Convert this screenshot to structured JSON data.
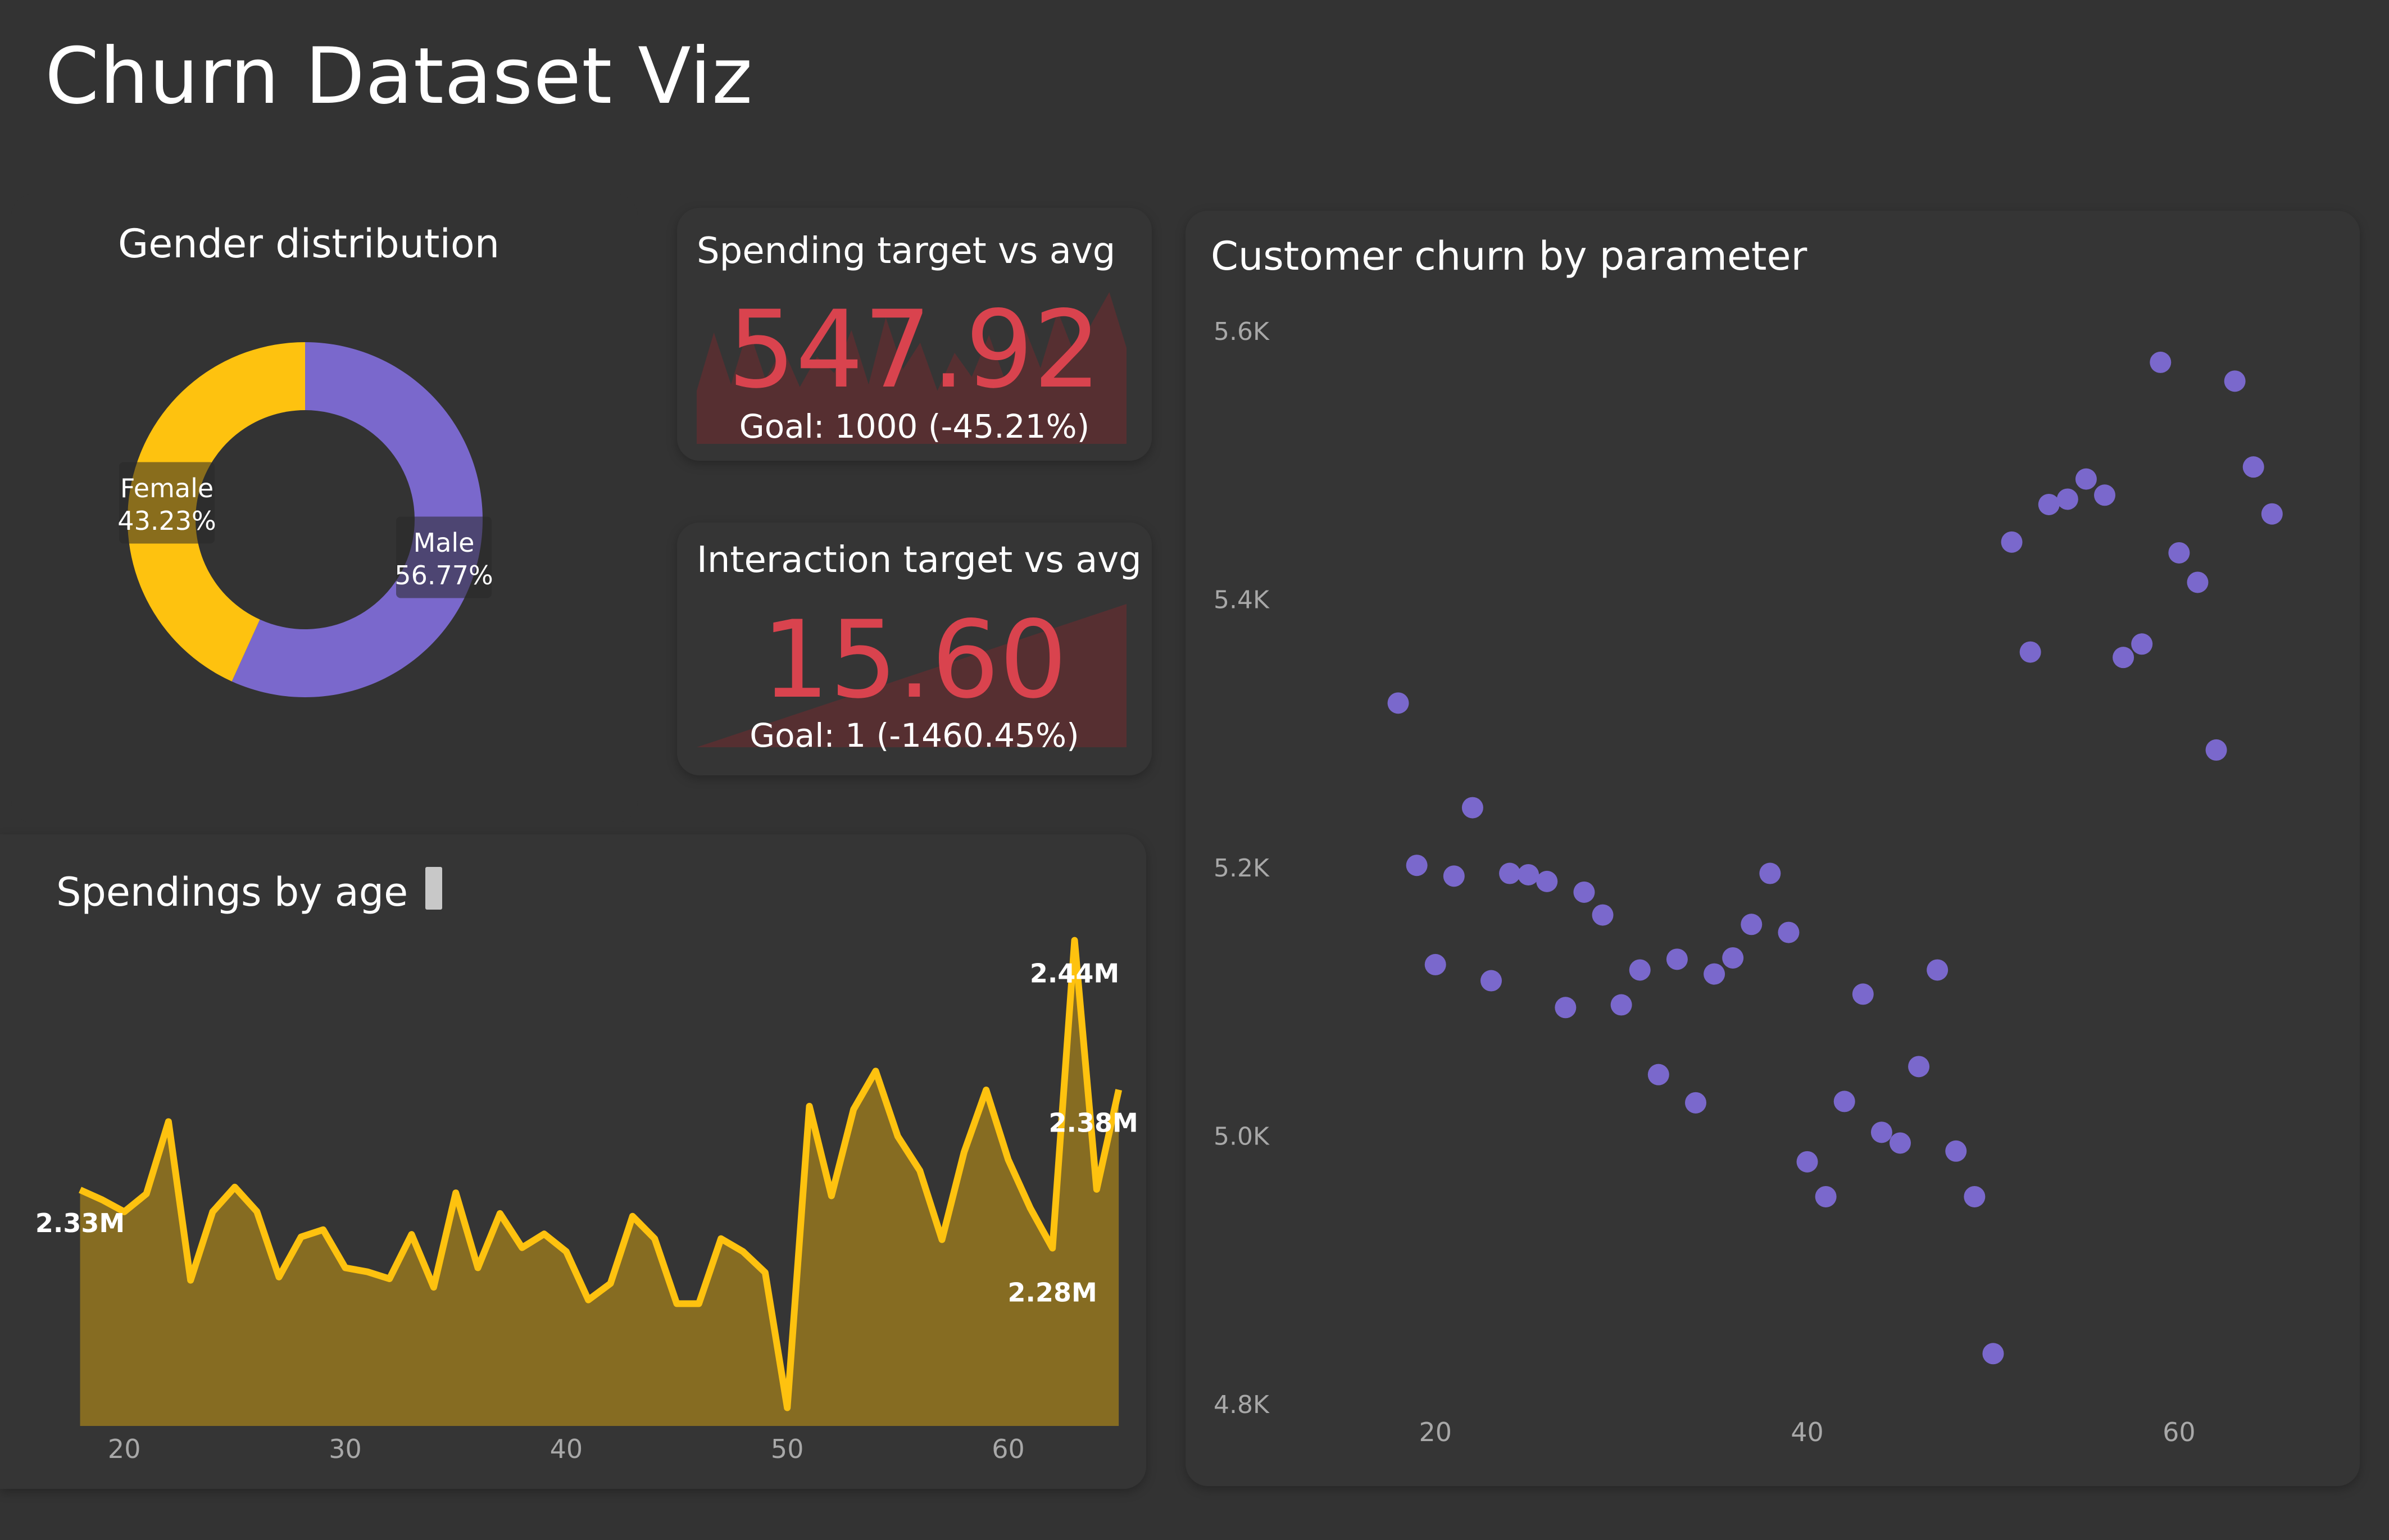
{
  "page": {
    "title": "Churn Dataset Viz"
  },
  "colors": {
    "background": "#333333",
    "male": "#7a68cc",
    "female": "#fec20f",
    "kpi": "#d9434e",
    "kpi_fill": "#5a2f31",
    "line": "#fec20f",
    "area": "#866c22",
    "scatter": "#7a68cc",
    "axis_text": "#a8a8a8"
  },
  "chart_data": [
    {
      "type": "pie",
      "title": "Gender distribution",
      "labels": [
        "Male",
        "Female"
      ],
      "values": [
        56.77,
        43.23
      ],
      "value_labels": [
        "56.77%",
        "43.23%"
      ]
    },
    {
      "type": "kpi",
      "title": "Spending target vs avg",
      "value": "547.92",
      "goal_text": "Goal: 1000 (-45.21%)",
      "trend": [
        420,
        880,
        470,
        920,
        510,
        760,
        450,
        690,
        560,
        900,
        470,
        1000,
        590,
        800,
        420,
        720,
        530,
        860,
        480,
        940,
        600,
        1050,
        700,
        960,
        1200,
        760
      ]
    },
    {
      "type": "kpi",
      "title": "Interaction target vs avg",
      "value": "15.60",
      "goal_text": "Goal: 1 (-1460.45%)",
      "trend": [
        0,
        100
      ]
    },
    {
      "type": "area",
      "title": "Spendings by age",
      "xlim": [
        17.3,
        65.3
      ],
      "xticks": [
        20,
        30,
        40,
        50,
        60
      ],
      "ylim": [
        2.245,
        2.46
      ],
      "x": [
        18,
        19,
        20,
        21,
        22,
        23,
        24,
        25,
        26,
        27,
        28,
        29,
        30,
        31,
        32,
        33,
        34,
        35,
        36,
        37,
        38,
        39,
        40,
        41,
        42,
        43,
        44,
        45,
        46,
        47,
        48,
        49,
        50,
        51,
        52,
        53,
        54,
        55,
        56,
        57,
        58,
        59,
        60,
        61,
        62,
        63,
        64,
        65
      ],
      "values": [
        2.3398,
        2.3358,
        2.331,
        2.3382,
        2.3672,
        2.3035,
        2.331,
        2.3409,
        2.3311,
        2.3048,
        2.3209,
        2.3238,
        2.3085,
        2.3069,
        2.3041,
        2.3219,
        2.3007,
        2.3386,
        2.3085,
        2.3303,
        2.3166,
        2.3221,
        2.315,
        2.2956,
        2.3022,
        2.3292,
        2.3202,
        2.2941,
        2.2941,
        2.3202,
        2.315,
        2.3066,
        2.2523,
        2.3734,
        2.3374,
        2.3721,
        2.3875,
        2.3613,
        2.3475,
        2.3198,
        2.3549,
        2.3799,
        2.3519,
        2.3324,
        2.3164,
        2.44,
        2.34,
        2.38
      ],
      "data_labels": [
        {
          "text": "2.33M",
          "x": 18
        },
        {
          "text": "2.44M",
          "x": 63
        },
        {
          "text": "2.38M",
          "x": 65
        },
        {
          "text": "2.28M",
          "x": 62
        }
      ]
    },
    {
      "type": "scatter",
      "title": "Customer churn by parameter",
      "xlim": [
        12,
        67
      ],
      "ylim": [
        4800,
        5600
      ],
      "xticks": [
        20,
        40,
        60
      ],
      "yticks": [
        4800,
        5000,
        5200,
        5400,
        5600
      ],
      "ytick_labels": [
        "4.8K",
        "5.0K",
        "5.2K",
        "5.4K",
        "5.6K"
      ],
      "points": [
        [
          18,
          5323
        ],
        [
          19,
          5202
        ],
        [
          20,
          5128
        ],
        [
          21,
          5194
        ],
        [
          22,
          5245
        ],
        [
          23,
          5116
        ],
        [
          24,
          5196
        ],
        [
          25,
          5195
        ],
        [
          26,
          5190
        ],
        [
          27,
          5096
        ],
        [
          28,
          5182
        ],
        [
          29,
          5165
        ],
        [
          30,
          5098
        ],
        [
          31,
          5124
        ],
        [
          32,
          5046
        ],
        [
          33,
          5132
        ],
        [
          34,
          5025
        ],
        [
          35,
          5121
        ],
        [
          36,
          5133
        ],
        [
          37,
          5158
        ],
        [
          38,
          5196
        ],
        [
          39,
          5152
        ],
        [
          40,
          4981
        ],
        [
          41,
          4955
        ],
        [
          42,
          5026
        ],
        [
          43,
          5106
        ],
        [
          44,
          5003
        ],
        [
          45,
          4995
        ],
        [
          46,
          5052
        ],
        [
          47,
          5124
        ],
        [
          48,
          4989
        ],
        [
          49,
          4955
        ],
        [
          50,
          4838
        ],
        [
          51,
          5443
        ],
        [
          52,
          5361
        ],
        [
          53,
          5471
        ],
        [
          54,
          5475
        ],
        [
          55,
          5490
        ],
        [
          56,
          5478
        ],
        [
          57,
          5357
        ],
        [
          58,
          5367
        ],
        [
          59,
          5577
        ],
        [
          60,
          5435
        ],
        [
          61,
          5413
        ],
        [
          62,
          5288
        ],
        [
          63,
          5563
        ],
        [
          64,
          5499
        ],
        [
          65,
          5464
        ]
      ]
    }
  ]
}
